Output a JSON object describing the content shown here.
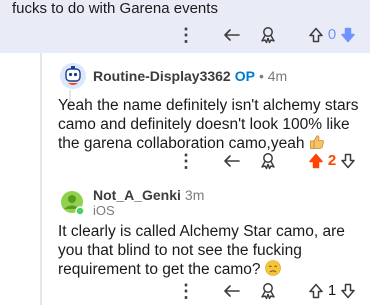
{
  "parent_comment": {
    "text_tail": "fucks to do with Garena events",
    "votes": "0",
    "vote_state": "downvoted",
    "vote_color": "#7193ff"
  },
  "comment1": {
    "author": "Routine-Display3362",
    "badge": "OP",
    "time": "• 4m",
    "body": "Yeah the name definitely isn't alchemy stars camo and definitely doesn't look 100% like the garena collaboration camo,yeah",
    "emoji": "thumbs-up",
    "votes": "2",
    "vote_state": "upvoted",
    "vote_color": "#ff4500"
  },
  "comment2": {
    "author": "Not_A_Genki",
    "time": "3m",
    "platform": "iOS",
    "body": "It clearly is called Alchemy Star camo, are you that blind to not see the fucking requirement to get the camo?",
    "emoji": "disappointed-face",
    "votes": "1",
    "vote_state": "none"
  },
  "icons": {
    "more": "more-options-icon",
    "reply": "reply-icon",
    "award": "award-icon",
    "upvote": "upvote-icon",
    "downvote": "downvote-icon"
  }
}
